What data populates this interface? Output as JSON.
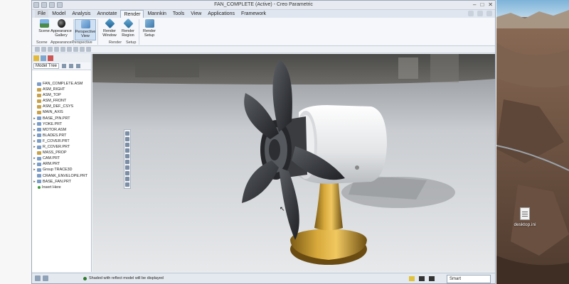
{
  "window": {
    "title": "FAN_COMPLETE (Active) - Creo Parametric"
  },
  "menu": [
    "File",
    "Model",
    "Analysis",
    "Annotate",
    "Render",
    "Mannkin",
    "Tools",
    "View",
    "Applications",
    "Framework"
  ],
  "active_menu": "Render",
  "ribbon": {
    "scene": "Scene",
    "appearance": "Appearance Gallery",
    "perspective": "Perspective View",
    "render_window": "Render Window",
    "render_region": "Render Region",
    "render_setup": "Render Setup",
    "groups": [
      "Scene",
      "Appearance",
      "Perspective",
      "Render",
      "Setup"
    ]
  },
  "model_tree": {
    "tab": "Model Tree",
    "items": [
      {
        "label": "FAN_COMPLETE.ASM",
        "arrow": "",
        "type": "asm"
      },
      {
        "label": "ASM_RIGHT",
        "arrow": "",
        "type": "plane"
      },
      {
        "label": "ASM_TOP",
        "arrow": "",
        "type": "plane"
      },
      {
        "label": "ASM_FRONT",
        "arrow": "",
        "type": "plane"
      },
      {
        "label": "ASM_DEF_CSYS",
        "arrow": "",
        "type": "plane"
      },
      {
        "label": "MAIN_AXIS",
        "arrow": "",
        "type": "plane"
      },
      {
        "label": "BASE_PIN.PRT",
        "arrow": "▸",
        "type": "part"
      },
      {
        "label": "YOKE.PRT",
        "arrow": "▸",
        "type": "part"
      },
      {
        "label": "MOTOR.ASM",
        "arrow": "▸",
        "type": "part"
      },
      {
        "label": "BLADES.PRT",
        "arrow": "▸",
        "type": "part"
      },
      {
        "label": "F_COVER.PRT",
        "arrow": "▸",
        "type": "part"
      },
      {
        "label": "R_COVER.PRT",
        "arrow": "▸",
        "type": "part"
      },
      {
        "label": "MASS_PROP",
        "arrow": "",
        "type": "plane"
      },
      {
        "label": "CAM.PRT",
        "arrow": "▸",
        "type": "part"
      },
      {
        "label": "ARM.PRT",
        "arrow": "▸",
        "type": "part"
      },
      {
        "label": "Group TRACE3D",
        "arrow": "▸",
        "type": "part"
      },
      {
        "label": "CRANK_ENVELOPE.PRT",
        "arrow": "",
        "type": "part"
      },
      {
        "label": "BASE_FAN.PRT",
        "arrow": "▸",
        "type": "part"
      },
      {
        "label": "Insert Here",
        "arrow": "",
        "type": "insert"
      }
    ]
  },
  "status": {
    "message": "Shaded with reflect model will be displayed",
    "filter": "Smart"
  },
  "desktop": {
    "file_label": "desktop.ini"
  },
  "colors": {
    "accent": "#cfe0f3",
    "base_gold": "#c9962a",
    "housing": "#e6e8ea",
    "blade": "#3c3e42"
  }
}
